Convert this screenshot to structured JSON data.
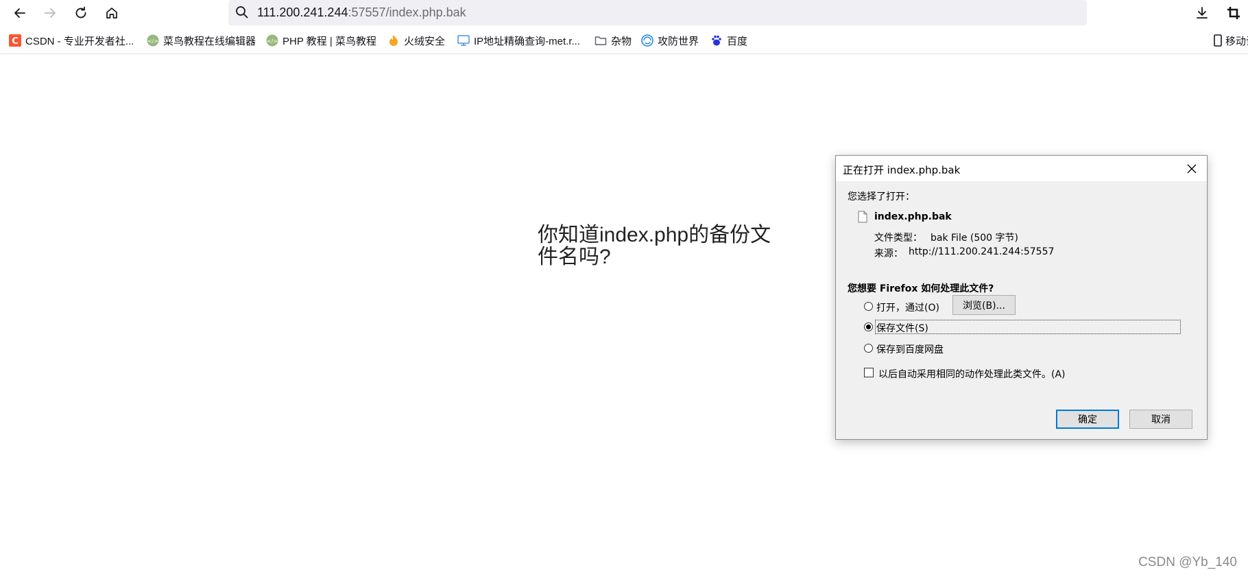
{
  "toolbar": {
    "url_host": "111.200.241.244",
    "url_rest": ":57557/index.php.bak"
  },
  "bookmarks": [
    {
      "label": "CSDN - 专业开发者社...",
      "icon": "csdn-icon",
      "color": "#fc5531"
    },
    {
      "label": "菜鸟教程在线编辑器",
      "icon": "runoob-icon",
      "color": "#96b97d"
    },
    {
      "label": "PHP 教程 | 菜鸟教程",
      "icon": "runoob-icon",
      "color": "#96b97d"
    },
    {
      "label": "火绒安全",
      "icon": "huorong-icon",
      "color": "#f5a623"
    },
    {
      "label": "IP地址精确查询-met.r...",
      "icon": "monitor-icon",
      "color": "#4a90e2"
    },
    {
      "label": "杂物",
      "icon": "folder-icon",
      "color": "#5b5b66"
    },
    {
      "label": "攻防世界",
      "icon": "adworld-icon",
      "color": "#1e88e5"
    },
    {
      "label": "百度",
      "icon": "baidu-icon",
      "color": "#2932e1"
    }
  ],
  "mobile_bookmarks": "移动设",
  "page": {
    "question": "你知道index.php的备份文件名吗?"
  },
  "dialog": {
    "title": "正在打开 index.php.bak",
    "chosen_label": "您选择了打开：",
    "filename": "index.php.bak",
    "filetype_label": "文件类型：",
    "filetype_value": "bak File (500 字节)",
    "source_label": "来源：",
    "source_value": "http://111.200.241.244:57557",
    "question": "您想要 Firefox 如何处理此文件?",
    "open_with": "打开，通过(O)",
    "browse_button": "浏览(B)...",
    "save_file": "保存文件(S)",
    "save_baidu": "保存到百度网盘",
    "auto_checkbox": "以后自动采用相同的动作处理此类文件。(A)",
    "ok_button": "确定",
    "cancel_button": "取消",
    "selected_option": "save_file"
  },
  "watermark": "CSDN @Yb_140",
  "colors": {
    "accent": "#0078d7",
    "urlbar_bg": "#f0f0f4",
    "dialog_bg": "#f0f0f0"
  }
}
